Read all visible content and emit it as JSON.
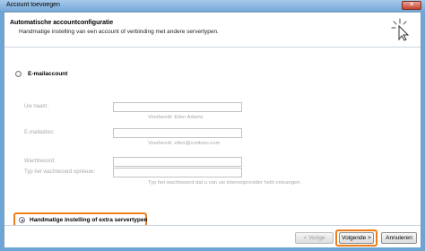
{
  "window": {
    "title": "Account toevoegen",
    "close_label": "✕"
  },
  "header": {
    "title": "Automatische accountconfiguratie",
    "subtitle": "Handmatige instelling van een account of verbinding met andere servertypen."
  },
  "email_account": {
    "radio_label": "E-mailaccount",
    "fields": [
      {
        "label": "Uw naam:",
        "value": "",
        "hint": "Voorbeeld: Ellen Adams"
      },
      {
        "label": "E-mailadres:",
        "value": "",
        "hint": "Voorbeeld: ellen@contoso.com"
      },
      {
        "label": "Wachtwoord:",
        "value": "",
        "hint": ""
      },
      {
        "label": "Typ het wachtwoord opnieuw:",
        "value": "",
        "hint": "Typ het wachtwoord dat u van uw internetprovider hebt ontvangen."
      }
    ]
  },
  "manual": {
    "radio_label": "Handmatige instelling of extra servertypen",
    "selected": true
  },
  "footer": {
    "prev_label": "< Vorige",
    "next_label": "Volgende >",
    "cancel_label": "Annuleren"
  },
  "colors": {
    "highlight": "#ef7d1a",
    "titlebar": "#78aadb"
  }
}
